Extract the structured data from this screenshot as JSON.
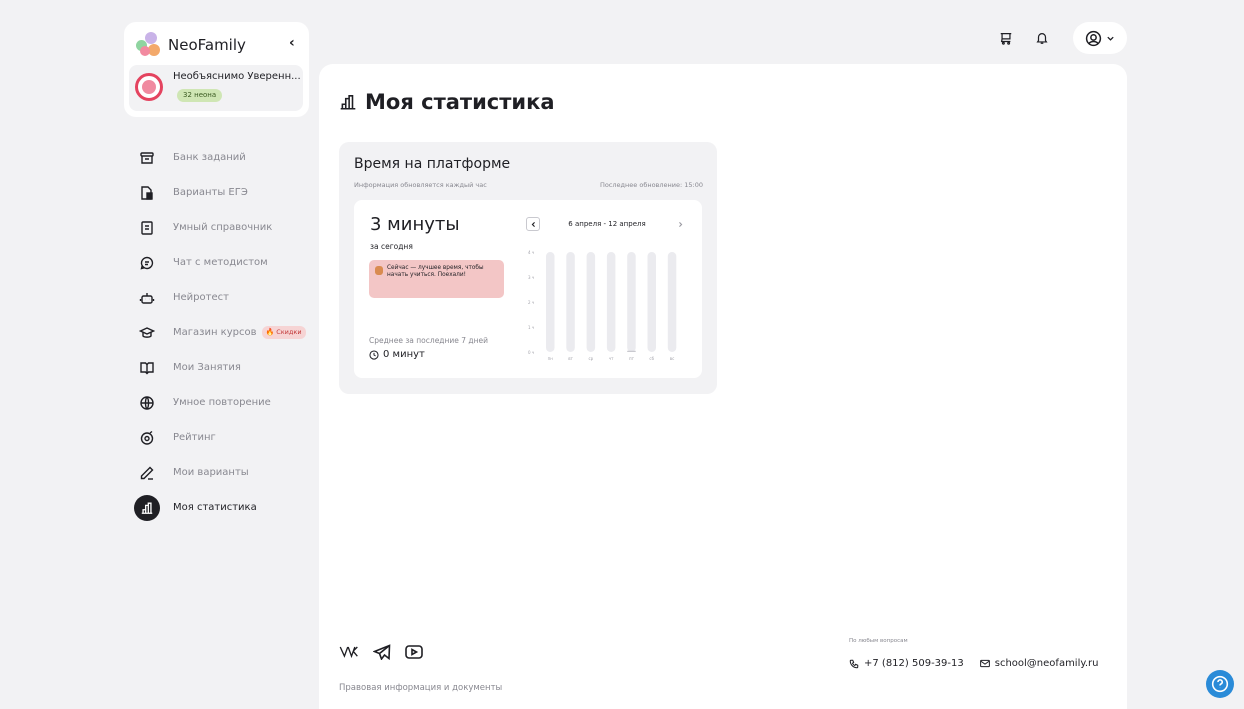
{
  "brand": {
    "name": "NeoFamily"
  },
  "user": {
    "name": "Необъяснимо Уверенн...",
    "neons": "32 неона"
  },
  "sidebar": {
    "items": [
      {
        "label": "Банк заданий",
        "icon": "archive-icon"
      },
      {
        "label": "Варианты ЕГЭ",
        "icon": "documents-icon"
      },
      {
        "label": "Умный справочник",
        "icon": "handbook-icon"
      },
      {
        "label": "Чат с методистом",
        "icon": "chat-icon"
      },
      {
        "label": "Нейротест",
        "icon": "robot-icon"
      },
      {
        "label": "Магазин курсов",
        "icon": "graduation-cap-icon",
        "badge": "Скидки"
      },
      {
        "label": "Мои Занятия",
        "icon": "book-icon"
      },
      {
        "label": "Умное повторение",
        "icon": "globe-icon"
      },
      {
        "label": "Рейтинг",
        "icon": "target-icon"
      },
      {
        "label": "Мои варианты",
        "icon": "pencil-icon"
      },
      {
        "label": "Моя статистика",
        "icon": "stats-icon",
        "active": true
      }
    ]
  },
  "page": {
    "title": "Моя статистика"
  },
  "stats": {
    "title": "Время на платформе",
    "subtitle": "Информация обновляется каждый час",
    "last_update": "Последнее обновление: 15:00",
    "today_value": "3 минуты",
    "today_label": "за сегодня",
    "tip": "Сейчас — лучшее время, чтобы начать учиться. Поехали!",
    "avg_label": "Среднее за последние 7 дней",
    "avg_value": "0 минут",
    "week_range": "6 апреля - 12 апреля"
  },
  "chart_data": {
    "type": "bar",
    "categories": [
      "пн",
      "вт",
      "ср",
      "чт",
      "пт",
      "сб",
      "вс"
    ],
    "values": [
      0,
      0,
      0,
      0,
      0.05,
      0,
      0
    ],
    "ylim": [
      0,
      4
    ],
    "y_ticks": [
      "4 ч",
      "3 ч",
      "2 ч",
      "1 ч",
      "0 ч"
    ],
    "bar_bg_color": "#ebebef",
    "bar_color": "#c9c9cf"
  },
  "footer": {
    "legal": "Правовая информация и документы",
    "contact_caption": "По любым вопросам",
    "phone": "+7 (812) 509-39-13",
    "email": "school@neofamily.ru",
    "social": [
      "vk-icon",
      "telegram-icon",
      "youtube-icon"
    ]
  },
  "colors": {
    "accent": "#e4435f",
    "help": "#2a8bd8",
    "dark": "#1f1f24"
  }
}
